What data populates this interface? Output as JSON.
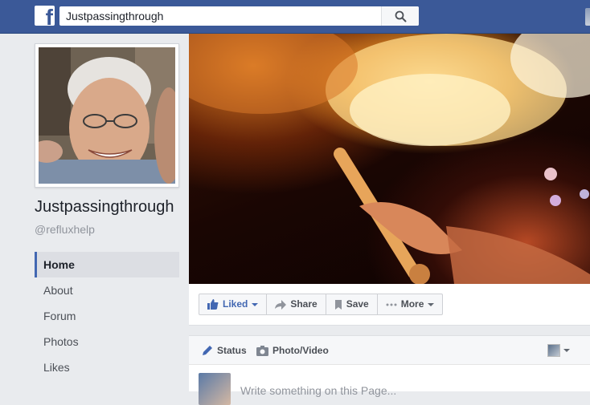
{
  "topbar": {
    "logo_letter": "f",
    "search_value": "Justpassingthrough",
    "search_icon": "search-icon",
    "brand_color": "#3b5998"
  },
  "page": {
    "name": "Justpassingthrough",
    "handle": "@refluxhelp"
  },
  "nav": {
    "items": [
      {
        "label": "Home",
        "active": true
      },
      {
        "label": "About",
        "active": false
      },
      {
        "label": "Forum",
        "active": false
      },
      {
        "label": "Photos",
        "active": false
      },
      {
        "label": "Likes",
        "active": false
      }
    ]
  },
  "actions": {
    "liked_label": "Liked",
    "share_label": "Share",
    "save_label": "Save",
    "more_label": "More",
    "accent_color": "#4267b2"
  },
  "composer": {
    "status_label": "Status",
    "photo_video_label": "Photo/Video",
    "placeholder": "Write something on this Page..."
  }
}
